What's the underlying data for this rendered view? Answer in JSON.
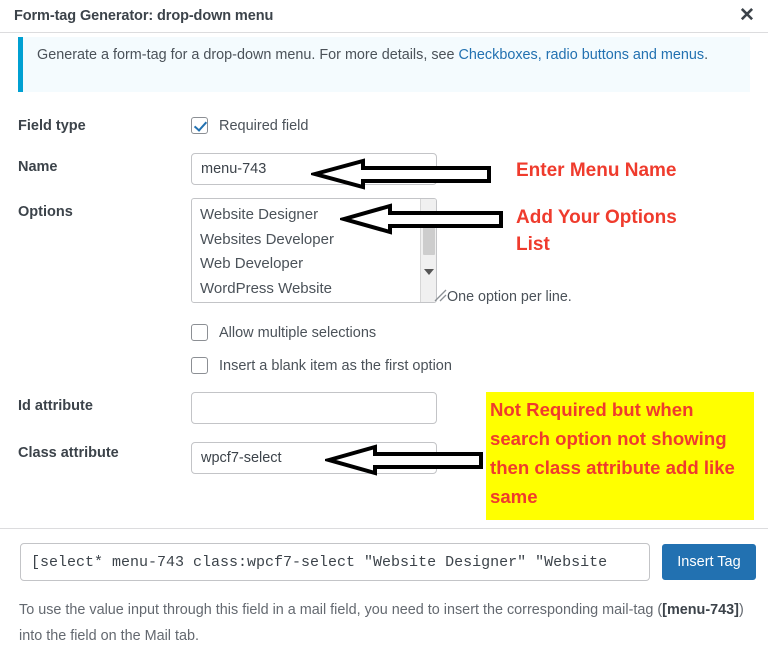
{
  "dialog": {
    "title": "Form-tag Generator: drop-down menu",
    "close_icon": "close-icon",
    "close_glyph": "✕"
  },
  "info": {
    "text_before": "Generate a form-tag for a drop-down menu. For more details, see ",
    "link_text": "Checkboxes, radio buttons and menus",
    "text_after": "."
  },
  "fields": {
    "field_type": {
      "label": "Field type",
      "checkbox_label": "Required field",
      "checked": true
    },
    "name": {
      "label": "Name",
      "value": "menu-743",
      "placeholder": ""
    },
    "options": {
      "label": "Options",
      "items": [
        "Website Designer",
        "Websites Developer",
        "Web Developer",
        "WordPress Website"
      ],
      "hint": "One option per line."
    },
    "allow_multiple": {
      "label": "Allow multiple selections",
      "checked": false
    },
    "insert_blank": {
      "label": "Insert a blank item as the first option",
      "checked": false
    },
    "id_attribute": {
      "label": "Id attribute",
      "value": "",
      "placeholder": ""
    },
    "class_attribute": {
      "label": "Class attribute",
      "value": "wpcf7-select",
      "placeholder": ""
    }
  },
  "annotations": {
    "name_note": "Enter Menu Name",
    "options_note": "Add Your Options\nList",
    "class_note": "Not Required but when search option not showing then class attribute add like same",
    "color_red": "#ef3b2d",
    "color_highlight": "#ffff00"
  },
  "footer": {
    "tag_value": "[select* menu-743 class:wpcf7-select \"Website Designer\" \"Website",
    "insert_button": "Insert Tag",
    "help_line1": "To use the value input through this field in a mail field, you need to insert the corresponding mail-tag",
    "help_prefix": "(",
    "help_mailtag": "[menu-743]",
    "help_line2": ") into the field on the Mail tab."
  }
}
